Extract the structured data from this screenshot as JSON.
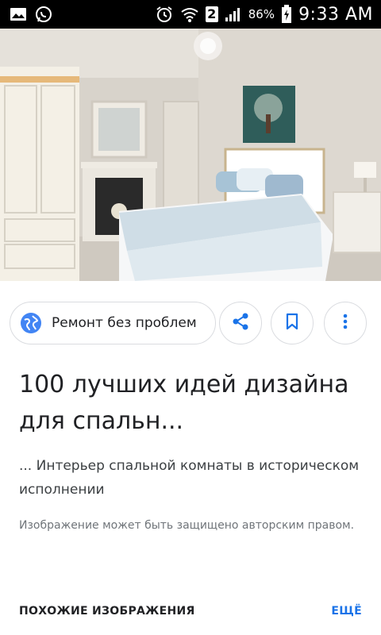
{
  "status_bar": {
    "battery_percent": "86%",
    "time": "9:33 AM",
    "sim_badge": "2"
  },
  "image": {
    "alt": "bedroom photo"
  },
  "source": {
    "label": "Ремонт без проблем",
    "icon": "globe-icon"
  },
  "actions": {
    "share_icon": "share-icon",
    "save_icon": "bookmark-icon",
    "more_icon": "more-vert-icon"
  },
  "result": {
    "title": "100 лучших идей дизайна для спальн...",
    "subtitle": "... Интерьер спальной комнаты в историческом исполнении",
    "copyright": "Изображение может быть защищено авторским правом."
  },
  "similar": {
    "heading": "ПОХОЖИЕ ИЗОБРАЖЕНИЯ",
    "more": "ЕЩЁ"
  },
  "colors": {
    "accent": "#1a73e8",
    "globe": "#4285f4"
  }
}
